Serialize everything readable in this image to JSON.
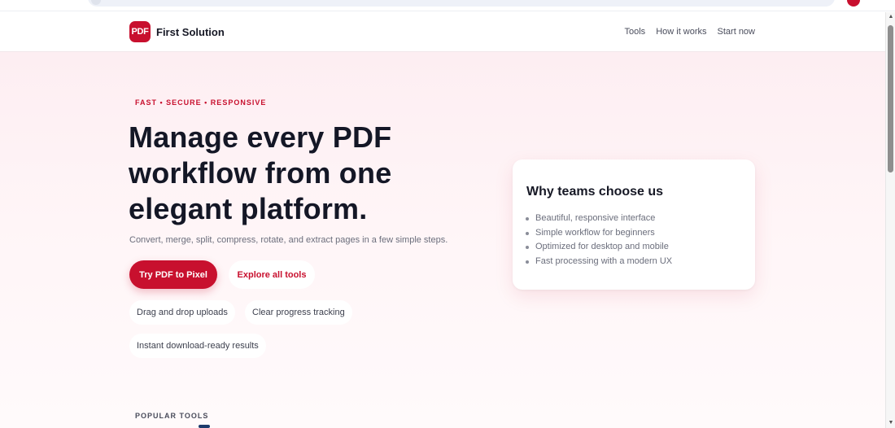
{
  "brand": {
    "logo_text": "PDF",
    "name": "First Solution"
  },
  "nav": {
    "items": [
      "Tools",
      "How it works",
      "Start now"
    ]
  },
  "hero": {
    "eyebrow": "FAST • SECURE • RESPONSIVE",
    "headline_lines": [
      "Manage every PDF",
      "workflow from one",
      "elegant platform."
    ],
    "subtext": "Convert, merge, split, compress, rotate, and extract pages in a few simple steps.",
    "primary_button": "Try PDF to Pixel",
    "secondary_button": "Explore all tools",
    "chips": [
      "Drag and drop uploads",
      "Clear progress tracking",
      "Instant download-ready results"
    ]
  },
  "card": {
    "title": "Why teams choose us",
    "items": [
      "Beautiful, responsive interface",
      "Simple workflow for beginners",
      "Optimized for desktop and mobile",
      "Fast processing with a modern UX"
    ]
  },
  "section": {
    "popular_label": "POPULAR TOOLS"
  },
  "icons": {
    "scroll_up": "triangle-up-icon",
    "scroll_down": "triangle-down-icon"
  },
  "colors": {
    "accent": "#c8102e",
    "hero_bg": "#fdeef2"
  }
}
